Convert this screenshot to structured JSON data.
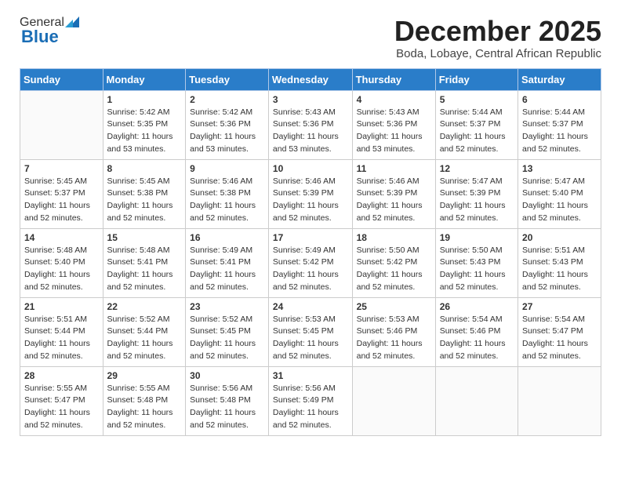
{
  "header": {
    "logo_general": "General",
    "logo_blue": "Blue",
    "month_title": "December 2025",
    "location": "Boda, Lobaye, Central African Republic"
  },
  "weekdays": [
    "Sunday",
    "Monday",
    "Tuesday",
    "Wednesday",
    "Thursday",
    "Friday",
    "Saturday"
  ],
  "weeks": [
    [
      {
        "day": "",
        "sunrise": "",
        "sunset": "",
        "daylight": ""
      },
      {
        "day": "1",
        "sunrise": "Sunrise: 5:42 AM",
        "sunset": "Sunset: 5:35 PM",
        "daylight": "Daylight: 11 hours and 53 minutes."
      },
      {
        "day": "2",
        "sunrise": "Sunrise: 5:42 AM",
        "sunset": "Sunset: 5:36 PM",
        "daylight": "Daylight: 11 hours and 53 minutes."
      },
      {
        "day": "3",
        "sunrise": "Sunrise: 5:43 AM",
        "sunset": "Sunset: 5:36 PM",
        "daylight": "Daylight: 11 hours and 53 minutes."
      },
      {
        "day": "4",
        "sunrise": "Sunrise: 5:43 AM",
        "sunset": "Sunset: 5:36 PM",
        "daylight": "Daylight: 11 hours and 53 minutes."
      },
      {
        "day": "5",
        "sunrise": "Sunrise: 5:44 AM",
        "sunset": "Sunset: 5:37 PM",
        "daylight": "Daylight: 11 hours and 52 minutes."
      },
      {
        "day": "6",
        "sunrise": "Sunrise: 5:44 AM",
        "sunset": "Sunset: 5:37 PM",
        "daylight": "Daylight: 11 hours and 52 minutes."
      }
    ],
    [
      {
        "day": "7",
        "sunrise": "Sunrise: 5:45 AM",
        "sunset": "Sunset: 5:37 PM",
        "daylight": "Daylight: 11 hours and 52 minutes."
      },
      {
        "day": "8",
        "sunrise": "Sunrise: 5:45 AM",
        "sunset": "Sunset: 5:38 PM",
        "daylight": "Daylight: 11 hours and 52 minutes."
      },
      {
        "day": "9",
        "sunrise": "Sunrise: 5:46 AM",
        "sunset": "Sunset: 5:38 PM",
        "daylight": "Daylight: 11 hours and 52 minutes."
      },
      {
        "day": "10",
        "sunrise": "Sunrise: 5:46 AM",
        "sunset": "Sunset: 5:39 PM",
        "daylight": "Daylight: 11 hours and 52 minutes."
      },
      {
        "day": "11",
        "sunrise": "Sunrise: 5:46 AM",
        "sunset": "Sunset: 5:39 PM",
        "daylight": "Daylight: 11 hours and 52 minutes."
      },
      {
        "day": "12",
        "sunrise": "Sunrise: 5:47 AM",
        "sunset": "Sunset: 5:39 PM",
        "daylight": "Daylight: 11 hours and 52 minutes."
      },
      {
        "day": "13",
        "sunrise": "Sunrise: 5:47 AM",
        "sunset": "Sunset: 5:40 PM",
        "daylight": "Daylight: 11 hours and 52 minutes."
      }
    ],
    [
      {
        "day": "14",
        "sunrise": "Sunrise: 5:48 AM",
        "sunset": "Sunset: 5:40 PM",
        "daylight": "Daylight: 11 hours and 52 minutes."
      },
      {
        "day": "15",
        "sunrise": "Sunrise: 5:48 AM",
        "sunset": "Sunset: 5:41 PM",
        "daylight": "Daylight: 11 hours and 52 minutes."
      },
      {
        "day": "16",
        "sunrise": "Sunrise: 5:49 AM",
        "sunset": "Sunset: 5:41 PM",
        "daylight": "Daylight: 11 hours and 52 minutes."
      },
      {
        "day": "17",
        "sunrise": "Sunrise: 5:49 AM",
        "sunset": "Sunset: 5:42 PM",
        "daylight": "Daylight: 11 hours and 52 minutes."
      },
      {
        "day": "18",
        "sunrise": "Sunrise: 5:50 AM",
        "sunset": "Sunset: 5:42 PM",
        "daylight": "Daylight: 11 hours and 52 minutes."
      },
      {
        "day": "19",
        "sunrise": "Sunrise: 5:50 AM",
        "sunset": "Sunset: 5:43 PM",
        "daylight": "Daylight: 11 hours and 52 minutes."
      },
      {
        "day": "20",
        "sunrise": "Sunrise: 5:51 AM",
        "sunset": "Sunset: 5:43 PM",
        "daylight": "Daylight: 11 hours and 52 minutes."
      }
    ],
    [
      {
        "day": "21",
        "sunrise": "Sunrise: 5:51 AM",
        "sunset": "Sunset: 5:44 PM",
        "daylight": "Daylight: 11 hours and 52 minutes."
      },
      {
        "day": "22",
        "sunrise": "Sunrise: 5:52 AM",
        "sunset": "Sunset: 5:44 PM",
        "daylight": "Daylight: 11 hours and 52 minutes."
      },
      {
        "day": "23",
        "sunrise": "Sunrise: 5:52 AM",
        "sunset": "Sunset: 5:45 PM",
        "daylight": "Daylight: 11 hours and 52 minutes."
      },
      {
        "day": "24",
        "sunrise": "Sunrise: 5:53 AM",
        "sunset": "Sunset: 5:45 PM",
        "daylight": "Daylight: 11 hours and 52 minutes."
      },
      {
        "day": "25",
        "sunrise": "Sunrise: 5:53 AM",
        "sunset": "Sunset: 5:46 PM",
        "daylight": "Daylight: 11 hours and 52 minutes."
      },
      {
        "day": "26",
        "sunrise": "Sunrise: 5:54 AM",
        "sunset": "Sunset: 5:46 PM",
        "daylight": "Daylight: 11 hours and 52 minutes."
      },
      {
        "day": "27",
        "sunrise": "Sunrise: 5:54 AM",
        "sunset": "Sunset: 5:47 PM",
        "daylight": "Daylight: 11 hours and 52 minutes."
      }
    ],
    [
      {
        "day": "28",
        "sunrise": "Sunrise: 5:55 AM",
        "sunset": "Sunset: 5:47 PM",
        "daylight": "Daylight: 11 hours and 52 minutes."
      },
      {
        "day": "29",
        "sunrise": "Sunrise: 5:55 AM",
        "sunset": "Sunset: 5:48 PM",
        "daylight": "Daylight: 11 hours and 52 minutes."
      },
      {
        "day": "30",
        "sunrise": "Sunrise: 5:56 AM",
        "sunset": "Sunset: 5:48 PM",
        "daylight": "Daylight: 11 hours and 52 minutes."
      },
      {
        "day": "31",
        "sunrise": "Sunrise: 5:56 AM",
        "sunset": "Sunset: 5:49 PM",
        "daylight": "Daylight: 11 hours and 52 minutes."
      },
      {
        "day": "",
        "sunrise": "",
        "sunset": "",
        "daylight": ""
      },
      {
        "day": "",
        "sunrise": "",
        "sunset": "",
        "daylight": ""
      },
      {
        "day": "",
        "sunrise": "",
        "sunset": "",
        "daylight": ""
      }
    ]
  ]
}
